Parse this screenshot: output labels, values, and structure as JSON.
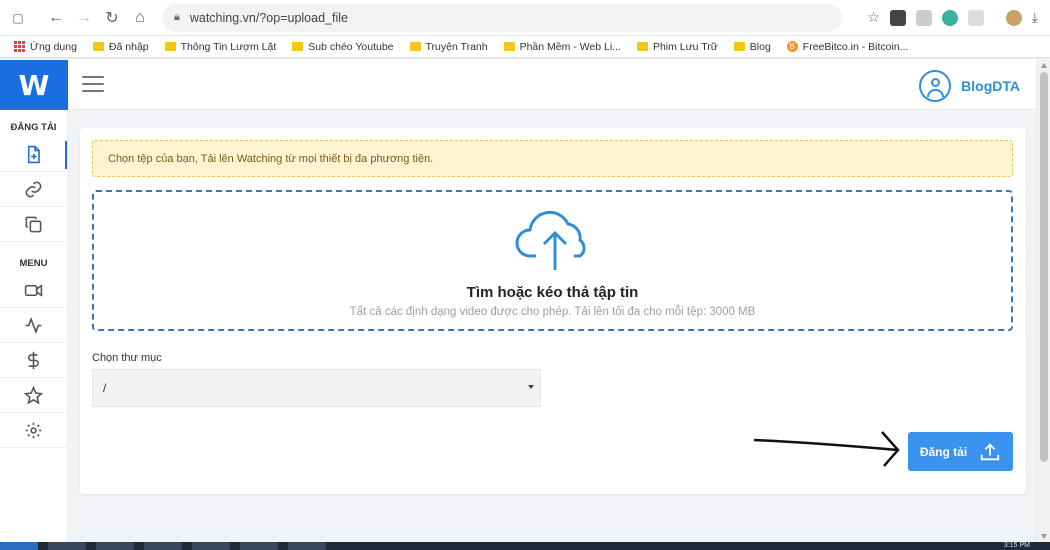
{
  "browser": {
    "url": "watching.vn/?op=upload_file",
    "bookmarks": [
      "Ứng dụng",
      "Đã nhập",
      "Thông Tin Lượm Lặt",
      "Sub chéo Youtube",
      "Truyện Tranh",
      "Phần Mềm - Web Li...",
      "Phim Lưu Trữ",
      "Blog",
      "FreeBitco.in - Bitcoin..."
    ]
  },
  "header": {
    "logo_letter": "W",
    "username": "BlogDTA"
  },
  "sidebar": {
    "upload_section": "ĐĂNG TẢI",
    "menu_section": "MENU",
    "upload_items": [
      "add-file-icon",
      "link-icon",
      "copy-icon"
    ],
    "menu_items": [
      "video-camera-icon",
      "activity-icon",
      "dollar-icon",
      "star-icon",
      "settings-icon"
    ]
  },
  "main": {
    "alert_text": "Chọn tệp của bạn, Tải lên Watching từ mọi thiết bị đa phương tiện.",
    "drop_title": "Tìm hoặc kéo thả tập tin",
    "drop_subtitle": "Tất cả các định dạng video được cho phép. Tải lên tối đa cho mỗi tệp: 3000 MB",
    "folder_label": "Chọn thư mục",
    "folder_value": "/",
    "upload_button": "Đăng tải"
  },
  "taskbar": {
    "time": "3:15 PM"
  },
  "colors": {
    "brand": "#1a6ee0",
    "button": "#3a93ee",
    "alert_bg": "#fff4d2",
    "dropzone_border": "#3a78b5"
  }
}
